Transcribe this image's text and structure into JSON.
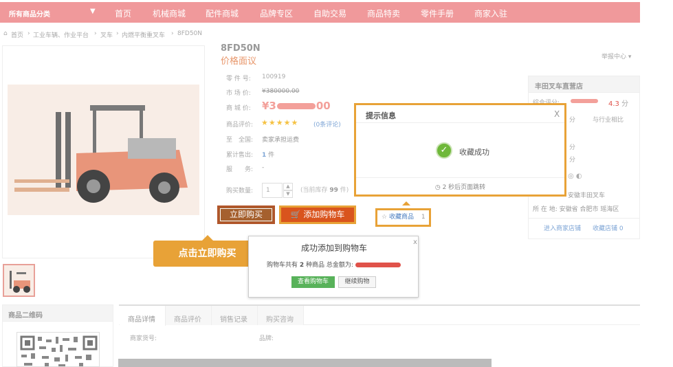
{
  "nav": {
    "category_label": "所有商品分类",
    "items": [
      "首页",
      "机械商城",
      "配件商城",
      "品牌专区",
      "自助交易",
      "商品特卖",
      "零件手册",
      "商家入驻"
    ]
  },
  "breadcrumb": [
    "首页",
    "工业车辆、作业平台",
    "叉车",
    "内燃平衡重叉车",
    "8FD50N"
  ],
  "product": {
    "model": "8FD50N",
    "price_label": "价格面议",
    "report": "举报中心",
    "fields": {
      "part_no_label": "零 件 号:",
      "part_no_value": "100919",
      "market_price_label": "市 场 价:",
      "market_price_value": "¥380000.00",
      "mall_price_label": "商 城 价:",
      "mall_price_value": "¥3",
      "mall_price_tail": "00",
      "rating_label": "商品评价:",
      "rating_stars": "★★★★★",
      "rating_link": "(0条评论)",
      "shipping_label": "至　全国:",
      "shipping_value": "卖家承担运费",
      "sold_label": "累计售出:",
      "sold_count": "1",
      "sold_unit": "件",
      "service_label": "服　　务:",
      "service_value": "-",
      "qty_label": "购买数量:",
      "qty_value": "1",
      "stock_prefix": "(当前库存",
      "stock_count": "99",
      "stock_suffix": "件)"
    }
  },
  "actions": {
    "buy_now": "立即购买",
    "add_cart": "添加购物车",
    "favorite": "收藏商品",
    "favorite_count": "1"
  },
  "callout": "点击立即购买",
  "cart_popup": {
    "title": "成功添加到购物车",
    "summary_prefix": "购物车共有",
    "count": "2",
    "summary_mid": "种商品 总金额为:",
    "view_cart": "查看购物车",
    "continue": "继续购物",
    "close": "x"
  },
  "dialog": {
    "title": "提示信息",
    "close": "X",
    "message": "收藏成功",
    "footer": "2 秒后页面跳转"
  },
  "store": {
    "name": "丰田叉车直营店",
    "score_label": "综合评分:",
    "score": "4.3",
    "score_unit": "分",
    "compare": "与行业相比",
    "unit1": "分",
    "unit2": "分",
    "unit3": "分",
    "contact_partial": "安徽丰田叉车",
    "location": "所 在 地: 安徽省 合肥市 瑶海区",
    "enter_store": "进入商家店铺",
    "favorite_store": "收藏店铺",
    "favorite_store_count": "0"
  },
  "qr": {
    "title": "商品二维码"
  },
  "tabs": [
    "商品详情",
    "商品评价",
    "销售记录",
    "购买咨询"
  ],
  "details": {
    "vendor_code_label": "商家货号:",
    "brand_label": "品牌:"
  },
  "colors": {
    "nav": "#f0999b",
    "accent": "#e8a237",
    "price": "#e0524a",
    "link": "#4a7dc0",
    "green": "#58b25a"
  }
}
